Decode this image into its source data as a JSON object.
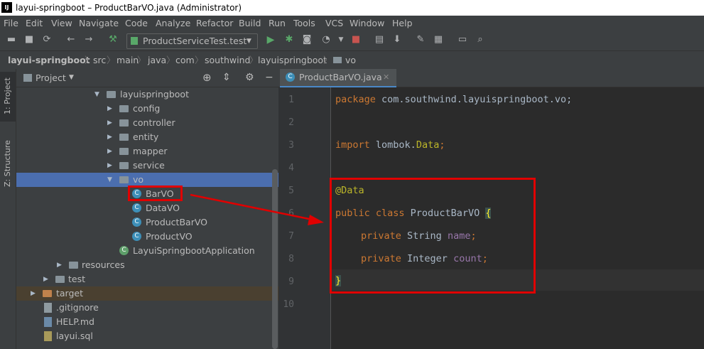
{
  "window": {
    "title": "layui-springboot – ProductBarVO.java (Administrator)",
    "logo": "IJ"
  },
  "menu": [
    "File",
    "Edit",
    "View",
    "Navigate",
    "Code",
    "Analyze",
    "Refactor",
    "Build",
    "Run",
    "Tools",
    "VCS",
    "Window",
    "Help"
  ],
  "toolbar": {
    "run_config": "ProductServiceTest.test"
  },
  "breadcrumb": [
    "layui-springboot",
    "src",
    "main",
    "java",
    "com",
    "southwind",
    "layuispringboot",
    "vo"
  ],
  "left_tabs": [
    "1: Project",
    "Z: Structure"
  ],
  "project_panel": {
    "title": "Project"
  },
  "tree": [
    {
      "label": "layuispringboot",
      "type": "package",
      "expanded": true
    },
    {
      "label": "config",
      "type": "package",
      "expanded": false
    },
    {
      "label": "controller",
      "type": "package",
      "expanded": false
    },
    {
      "label": "entity",
      "type": "package",
      "expanded": false
    },
    {
      "label": "mapper",
      "type": "package",
      "expanded": false
    },
    {
      "label": "service",
      "type": "package",
      "expanded": false
    },
    {
      "label": "vo",
      "type": "package",
      "expanded": true,
      "selected": true
    },
    {
      "label": "BarVO",
      "type": "class",
      "highlighted": true
    },
    {
      "label": "DataVO",
      "type": "class"
    },
    {
      "label": "ProductBarVO",
      "type": "class"
    },
    {
      "label": "ProductVO",
      "type": "class"
    },
    {
      "label": "LayuiSpringbootApplication",
      "type": "spring-class"
    },
    {
      "label": "resources",
      "type": "folder",
      "expanded": false
    },
    {
      "label": "test",
      "type": "folder",
      "expanded": false
    },
    {
      "label": "target",
      "type": "folder-excluded",
      "expanded": false
    },
    {
      "label": ".gitignore",
      "type": "file"
    },
    {
      "label": "HELP.md",
      "type": "md-file"
    },
    {
      "label": "layui.sql",
      "type": "sql-file"
    }
  ],
  "editor": {
    "tab_label": "ProductBarVO.java",
    "line_numbers": [
      "1",
      "2",
      "3",
      "4",
      "5",
      "6",
      "7",
      "8",
      "9",
      "10"
    ],
    "lines": {
      "l1_kw": "package",
      "l1_rest": " com.southwind.layuispringboot.vo;",
      "l3_kw": "import",
      "l3_rest": " lombok.",
      "l3_ann": "Data",
      "l3_end": ";",
      "l5_ann": "@Data",
      "l6_kw": "public class",
      "l6_name": " ProductBarVO ",
      "l6_brace": "{",
      "l7_kw": "private",
      "l7_type": " String ",
      "l7_field": "name",
      "l7_end": ";",
      "l8_kw": "private",
      "l8_type": " Integer ",
      "l8_field": "count",
      "l8_end": ";",
      "l9_brace": "}"
    }
  },
  "colors": {
    "annotation_red": "#e00000",
    "selection": "#4b6eaf",
    "keyword": "#cc7832"
  }
}
